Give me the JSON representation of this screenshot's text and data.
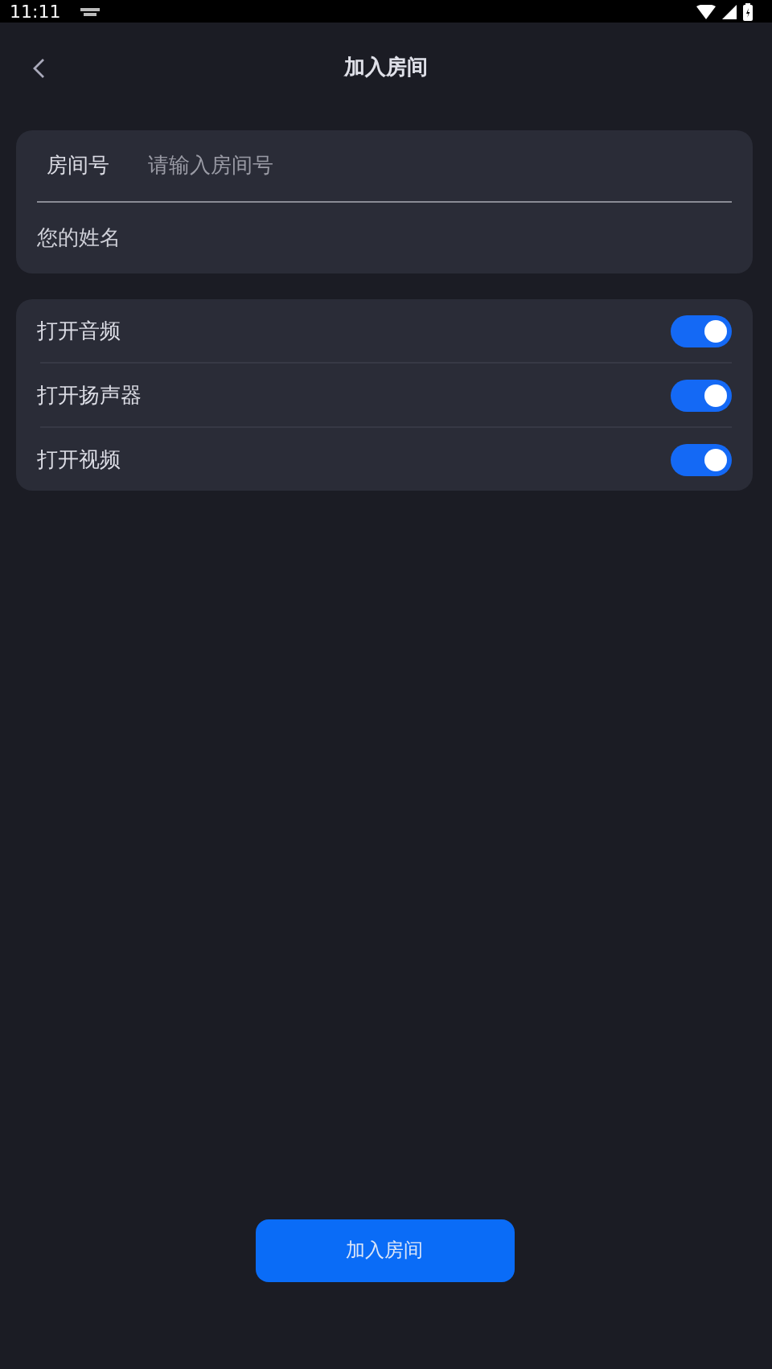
{
  "status_bar": {
    "time": "11:11"
  },
  "header": {
    "title": "加入房间"
  },
  "form": {
    "room": {
      "label": "房间号",
      "placeholder": "请输入房间号"
    },
    "name": {
      "placeholder": "您的姓名"
    }
  },
  "options": [
    {
      "label": "打开音频",
      "on": true
    },
    {
      "label": "打开扬声器",
      "on": true
    },
    {
      "label": "打开视频",
      "on": true
    }
  ],
  "join_button": "加入房间"
}
